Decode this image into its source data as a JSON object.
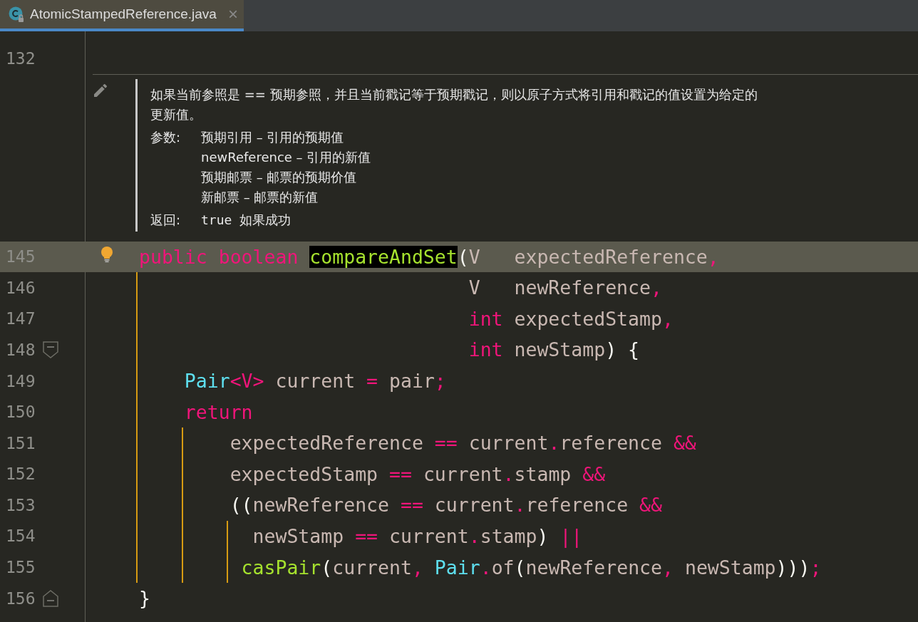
{
  "tabs": [
    {
      "label": "AtomicStampedReference.java",
      "selected": true,
      "close": "×"
    }
  ],
  "doc": {
    "line_number": "132",
    "description": "如果当前参照是 == 预期参照，并且当前戳记等于预期戳记，则以原子方式将引用和戳记的值设置为给定的更新值。",
    "sections": [
      {
        "label": "参数:",
        "items": [
          {
            "text": "预期引用 – 引用的预期值"
          },
          {
            "text": "newReference – 引用的新值"
          },
          {
            "text": "预期邮票 – 邮票的预期价值"
          },
          {
            "text": "新邮票 – 邮票的新值"
          }
        ]
      },
      {
        "label": "返回:",
        "items": [
          {
            "code": "true",
            "text": "如果成功"
          }
        ]
      }
    ]
  },
  "lines": [
    {
      "number": "145",
      "kind": "code",
      "highlighted": true,
      "bulb": true,
      "tokens": [
        {
          "kind": "kw",
          "text": "public boolean "
        },
        {
          "kind": "fnsel",
          "text": "compareAndSet"
        },
        {
          "kind": "plain",
          "text": "("
        },
        {
          "kind": "param",
          "text": "V   expectedReference"
        },
        {
          "kind": "op",
          "text": ","
        }
      ]
    },
    {
      "number": "146",
      "kind": "code",
      "highlighted": false,
      "bulb": false,
      "tokens": [
        {
          "kind": "param",
          "text": "                             V   newReference"
        },
        {
          "kind": "op",
          "text": ","
        }
      ]
    },
    {
      "number": "147",
      "kind": "code",
      "highlighted": false,
      "bulb": false,
      "tokens": [
        {
          "kind": "kw",
          "text": "                             int "
        },
        {
          "kind": "param",
          "text": "expectedStamp"
        },
        {
          "kind": "op",
          "text": ","
        }
      ]
    },
    {
      "number": "148",
      "kind": "fold_start",
      "highlighted": false,
      "bulb": false,
      "tokens": [
        {
          "kind": "kw",
          "text": "                             int "
        },
        {
          "kind": "param",
          "text": "newStamp"
        },
        {
          "kind": "plain",
          "text": ") {"
        }
      ]
    },
    {
      "number": "149",
      "kind": "code",
      "highlighted": false,
      "bulb": false,
      "tokens": [
        {
          "kind": "type",
          "text": "    Pair"
        },
        {
          "kind": "op",
          "text": "<V>"
        },
        {
          "kind": "param",
          "text": " current "
        },
        {
          "kind": "op",
          "text": "="
        },
        {
          "kind": "param",
          "text": " pair"
        },
        {
          "kind": "op",
          "text": ";"
        }
      ]
    },
    {
      "number": "150",
      "kind": "code",
      "highlighted": false,
      "bulb": false,
      "tokens": [
        {
          "kind": "kw",
          "text": "    return"
        }
      ]
    },
    {
      "number": "151",
      "kind": "code",
      "highlighted": false,
      "bulb": false,
      "tokens": [
        {
          "kind": "param",
          "text": "        expectedReference "
        },
        {
          "kind": "op",
          "text": "=="
        },
        {
          "kind": "param",
          "text": " current"
        },
        {
          "kind": "op",
          "text": "."
        },
        {
          "kind": "param",
          "text": "reference "
        },
        {
          "kind": "op",
          "text": "&&"
        }
      ]
    },
    {
      "number": "152",
      "kind": "code",
      "highlighted": false,
      "bulb": false,
      "tokens": [
        {
          "kind": "param",
          "text": "        expectedStamp "
        },
        {
          "kind": "op",
          "text": "=="
        },
        {
          "kind": "param",
          "text": " current"
        },
        {
          "kind": "op",
          "text": "."
        },
        {
          "kind": "param",
          "text": "stamp "
        },
        {
          "kind": "op",
          "text": "&&"
        }
      ]
    },
    {
      "number": "153",
      "kind": "code",
      "highlighted": false,
      "bulb": false,
      "tokens": [
        {
          "kind": "plain",
          "text": "        (("
        },
        {
          "kind": "param",
          "text": "newReference "
        },
        {
          "kind": "op",
          "text": "=="
        },
        {
          "kind": "param",
          "text": " current"
        },
        {
          "kind": "op",
          "text": "."
        },
        {
          "kind": "param",
          "text": "reference "
        },
        {
          "kind": "op",
          "text": "&&"
        }
      ]
    },
    {
      "number": "154",
      "kind": "code",
      "highlighted": false,
      "bulb": false,
      "tokens": [
        {
          "kind": "param",
          "text": "          newStamp "
        },
        {
          "kind": "op",
          "text": "=="
        },
        {
          "kind": "param",
          "text": " current"
        },
        {
          "kind": "op",
          "text": "."
        },
        {
          "kind": "param",
          "text": "stamp"
        },
        {
          "kind": "plain",
          "text": ") "
        },
        {
          "kind": "op",
          "text": "||"
        }
      ]
    },
    {
      "number": "155",
      "kind": "code",
      "highlighted": false,
      "bulb": false,
      "tokens": [
        {
          "kind": "fn",
          "text": "         casPair"
        },
        {
          "kind": "plain",
          "text": "("
        },
        {
          "kind": "param",
          "text": "current"
        },
        {
          "kind": "op",
          "text": ", "
        },
        {
          "kind": "type",
          "text": "Pair"
        },
        {
          "kind": "op",
          "text": "."
        },
        {
          "kind": "param",
          "text": "of"
        },
        {
          "kind": "plain",
          "text": "("
        },
        {
          "kind": "param",
          "text": "newReference"
        },
        {
          "kind": "op",
          "text": ", "
        },
        {
          "kind": "param",
          "text": "newStamp"
        },
        {
          "kind": "plain",
          "text": ")))"
        },
        {
          "kind": "op",
          "text": ";"
        }
      ]
    },
    {
      "number": "156",
      "kind": "fold_end",
      "highlighted": false,
      "bulb": false,
      "tokens": [
        {
          "kind": "plain",
          "text": "}"
        }
      ]
    }
  ]
}
